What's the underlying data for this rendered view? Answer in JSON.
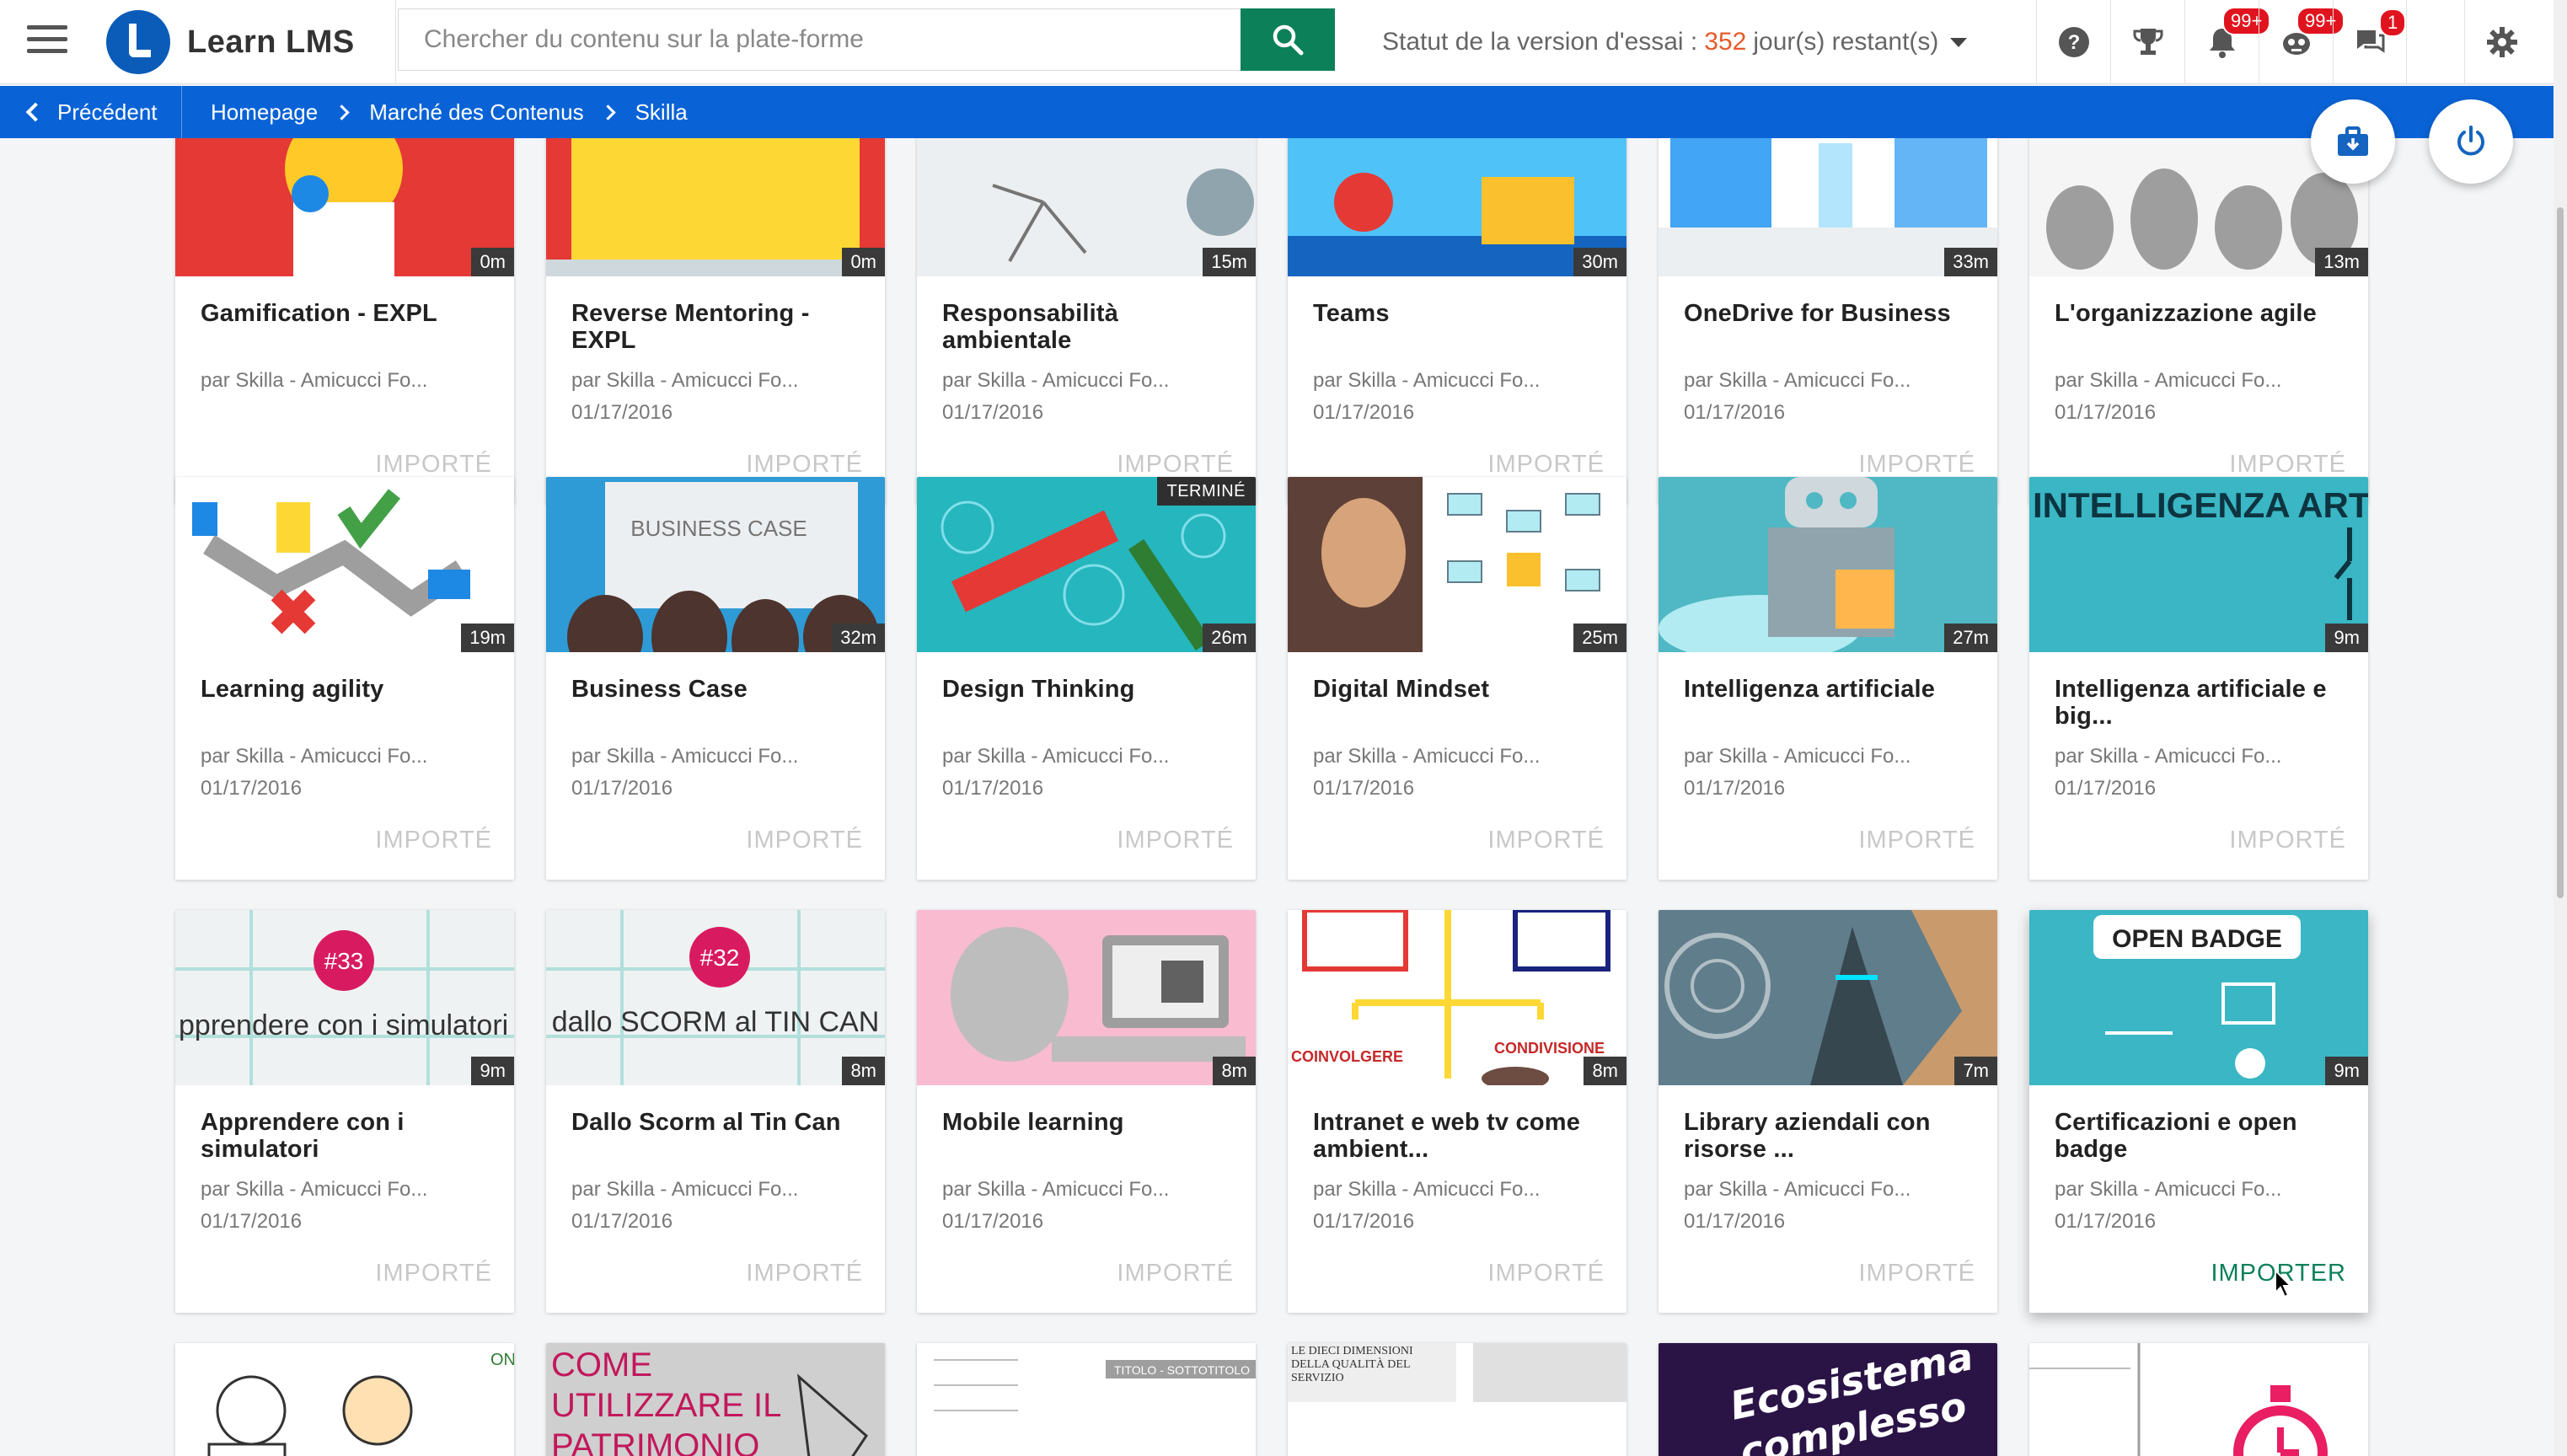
{
  "app": {
    "name": "Learn LMS"
  },
  "search": {
    "placeholder": "Chercher du contenu sur la plate-forme"
  },
  "trial": {
    "label": "Statut de la version d'essai :",
    "days": "352",
    "suffix": "jour(s) restant(s)"
  },
  "header": {
    "badges": {
      "notifications": "99+",
      "messages": "99+",
      "chat": "1"
    }
  },
  "breadcrumb": {
    "back_label": "Précédent",
    "items": [
      "Homepage",
      "Marché des Contenus",
      "Skilla"
    ]
  },
  "colors": {
    "primary": "#0a63d6",
    "accent": "#0c8059",
    "badge": "#e0141e",
    "trial_days": "#e55a2b"
  },
  "cards": [
    {
      "title": "Gamification - EXPL",
      "author": "par Skilla - Amicucci Fo...",
      "date": "",
      "duration": "0m",
      "action": "IMPORTÉ"
    },
    {
      "title": "Reverse Mentoring - EXPL",
      "author": "par Skilla - Amicucci Fo...",
      "date": "01/17/2016",
      "duration": "0m",
      "action": "IMPORTÉ"
    },
    {
      "title": "Responsabilità ambientale",
      "author": "par Skilla - Amicucci Fo...",
      "date": "01/17/2016",
      "duration": "15m",
      "action": "IMPORTÉ"
    },
    {
      "title": "Teams",
      "author": "par Skilla - Amicucci Fo...",
      "date": "01/17/2016",
      "duration": "30m",
      "action": "IMPORTÉ"
    },
    {
      "title": "OneDrive for Business",
      "author": "par Skilla - Amicucci Fo...",
      "date": "01/17/2016",
      "duration": "33m",
      "action": "IMPORTÉ"
    },
    {
      "title": "L'organizzazione agile",
      "author": "par Skilla - Amicucci Fo...",
      "date": "01/17/2016",
      "duration": "13m",
      "action": "IMPORTÉ"
    },
    {
      "title": "Learning agility",
      "author": "par Skilla - Amicucci Fo...",
      "date": "01/17/2016",
      "duration": "19m",
      "action": "IMPORTÉ"
    },
    {
      "title": "Business Case",
      "author": "par Skilla - Amicucci Fo...",
      "date": "01/17/2016",
      "duration": "32m",
      "action": "IMPORTÉ",
      "thumb_text": "BUSINESS CASE"
    },
    {
      "title": "Design Thinking",
      "author": "par Skilla - Amicucci Fo...",
      "date": "01/17/2016",
      "duration": "26m",
      "action": "IMPORTÉ",
      "status": "TERMINÉ"
    },
    {
      "title": "Digital Mindset",
      "author": "par Skilla - Amicucci Fo...",
      "date": "01/17/2016",
      "duration": "25m",
      "action": "IMPORTÉ"
    },
    {
      "title": "Intelligenza artificiale",
      "author": "par Skilla - Amicucci Fo...",
      "date": "01/17/2016",
      "duration": "27m",
      "action": "IMPORTÉ"
    },
    {
      "title": "Intelligenza artificiale e big...",
      "author": "par Skilla - Amicucci Fo...",
      "date": "01/17/2016",
      "duration": "9m",
      "action": "IMPORTÉ",
      "thumb_text": "INTELLIGENZA ARTIFICIALE"
    },
    {
      "title": "Apprendere con i simulatori",
      "author": "par Skilla - Amicucci Fo...",
      "date": "01/17/2016",
      "duration": "9m",
      "action": "IMPORTÉ",
      "thumb_text": "pprendere con i simulatori",
      "badge": "#33"
    },
    {
      "title": "Dallo Scorm al Tin Can",
      "author": "par Skilla - Amicucci Fo...",
      "date": "01/17/2016",
      "duration": "8m",
      "action": "IMPORTÉ",
      "thumb_text": "dallo SCORM al TIN CAN",
      "badge": "#32"
    },
    {
      "title": "Mobile learning",
      "author": "par Skilla - Amicucci Fo...",
      "date": "01/17/2016",
      "duration": "8m",
      "action": "IMPORTÉ"
    },
    {
      "title": "Intranet e web tv come ambient...",
      "author": "par Skilla - Amicucci Fo...",
      "date": "01/17/2016",
      "duration": "8m",
      "action": "IMPORTÉ",
      "thumb_text": "COINVOLGERE",
      "thumb_text_2": "CONDIVISIONE"
    },
    {
      "title": "Library aziendali con risorse ...",
      "author": "par Skilla - Amicucci Fo...",
      "date": "01/17/2016",
      "duration": "7m",
      "action": "IMPORTÉ"
    },
    {
      "title": "Certificazioni e open badge",
      "author": "par Skilla - Amicucci Fo...",
      "date": "01/17/2016",
      "duration": "9m",
      "action": "IMPORTER",
      "thumb_text": "OPEN BADGE"
    }
  ],
  "bottom_row": [
    {
      "thumb_text": "ON"
    },
    {
      "thumb_text": "COME UTILIZZARE IL PATRIMONIO CARTACEO DI"
    },
    {
      "thumb_text": "TITOLO - SOTTOTITOLO"
    },
    {
      "thumb_text": "LE DIECI DIMENSIONI DELLA QUALITÀ DEL SERVIZIO"
    },
    {
      "thumb_text": "Ecosistema complesso"
    },
    {
      "thumb_text": ""
    }
  ]
}
